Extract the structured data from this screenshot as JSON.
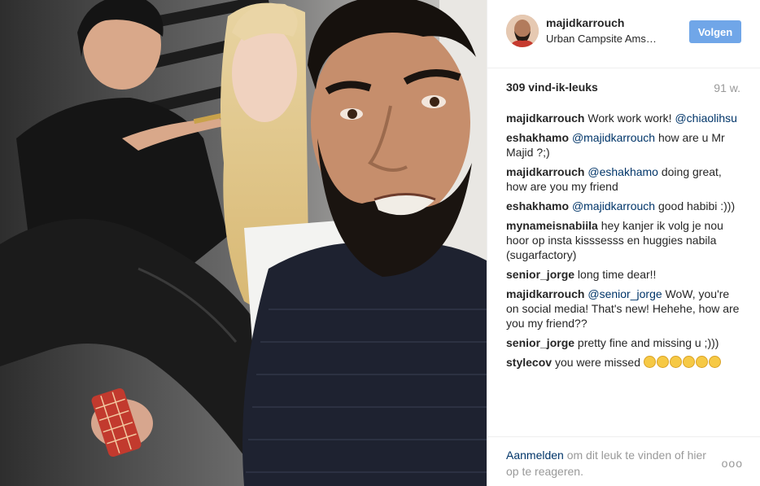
{
  "post": {
    "image_alt": "selfie of a bearded man with a makeup artist and model behind him",
    "username": "majidkarrouch",
    "location": "Urban Campsite Ams…",
    "follow_label": "Volgen",
    "likes": "309 vind-ik-leuks",
    "age": "91 w."
  },
  "comments": [
    {
      "user": "majidkarrouch",
      "parts": [
        {
          "t": "text",
          "v": "Work work work! "
        },
        {
          "t": "mention",
          "v": "@chiaolihsu"
        }
      ]
    },
    {
      "user": "eshakhamo",
      "parts": [
        {
          "t": "mention",
          "v": "@majidkarrouch"
        },
        {
          "t": "text",
          "v": " how are u Mr Majid ?;)"
        }
      ]
    },
    {
      "user": "majidkarrouch",
      "parts": [
        {
          "t": "mention",
          "v": "@eshakhamo"
        },
        {
          "t": "text",
          "v": " doing great, how are you my friend"
        }
      ]
    },
    {
      "user": "eshakhamo",
      "parts": [
        {
          "t": "mention",
          "v": "@majidkarrouch"
        },
        {
          "t": "text",
          "v": " good habibi :)))"
        }
      ]
    },
    {
      "user": "mynameisnabiila",
      "parts": [
        {
          "t": "text",
          "v": "hey kanjer ik volg je nou hoor op insta kisssesss en huggies nabila (sugarfactory)"
        }
      ]
    },
    {
      "user": "senior_jorge",
      "parts": [
        {
          "t": "text",
          "v": "long time dear!!"
        }
      ]
    },
    {
      "user": "majidkarrouch",
      "parts": [
        {
          "t": "mention",
          "v": "@senior_jorge"
        },
        {
          "t": "text",
          "v": " WoW, you're on social media! That's new! Hehehe, how are you my friend??"
        }
      ]
    },
    {
      "user": "senior_jorge",
      "parts": [
        {
          "t": "text",
          "v": "pretty fine and missing u ;)))"
        }
      ]
    },
    {
      "user": "stylecov",
      "parts": [
        {
          "t": "text",
          "v": "you were missed "
        },
        {
          "t": "emoji",
          "v": "6"
        }
      ]
    }
  ],
  "footer": {
    "login_link": "Aanmelden",
    "login_rest": " om dit leuk te vinden of hier op te reageren.",
    "more_label": "ooo"
  },
  "icons": {
    "more": "more-options-icon",
    "emoji": "sad-face-emoji-icon"
  }
}
